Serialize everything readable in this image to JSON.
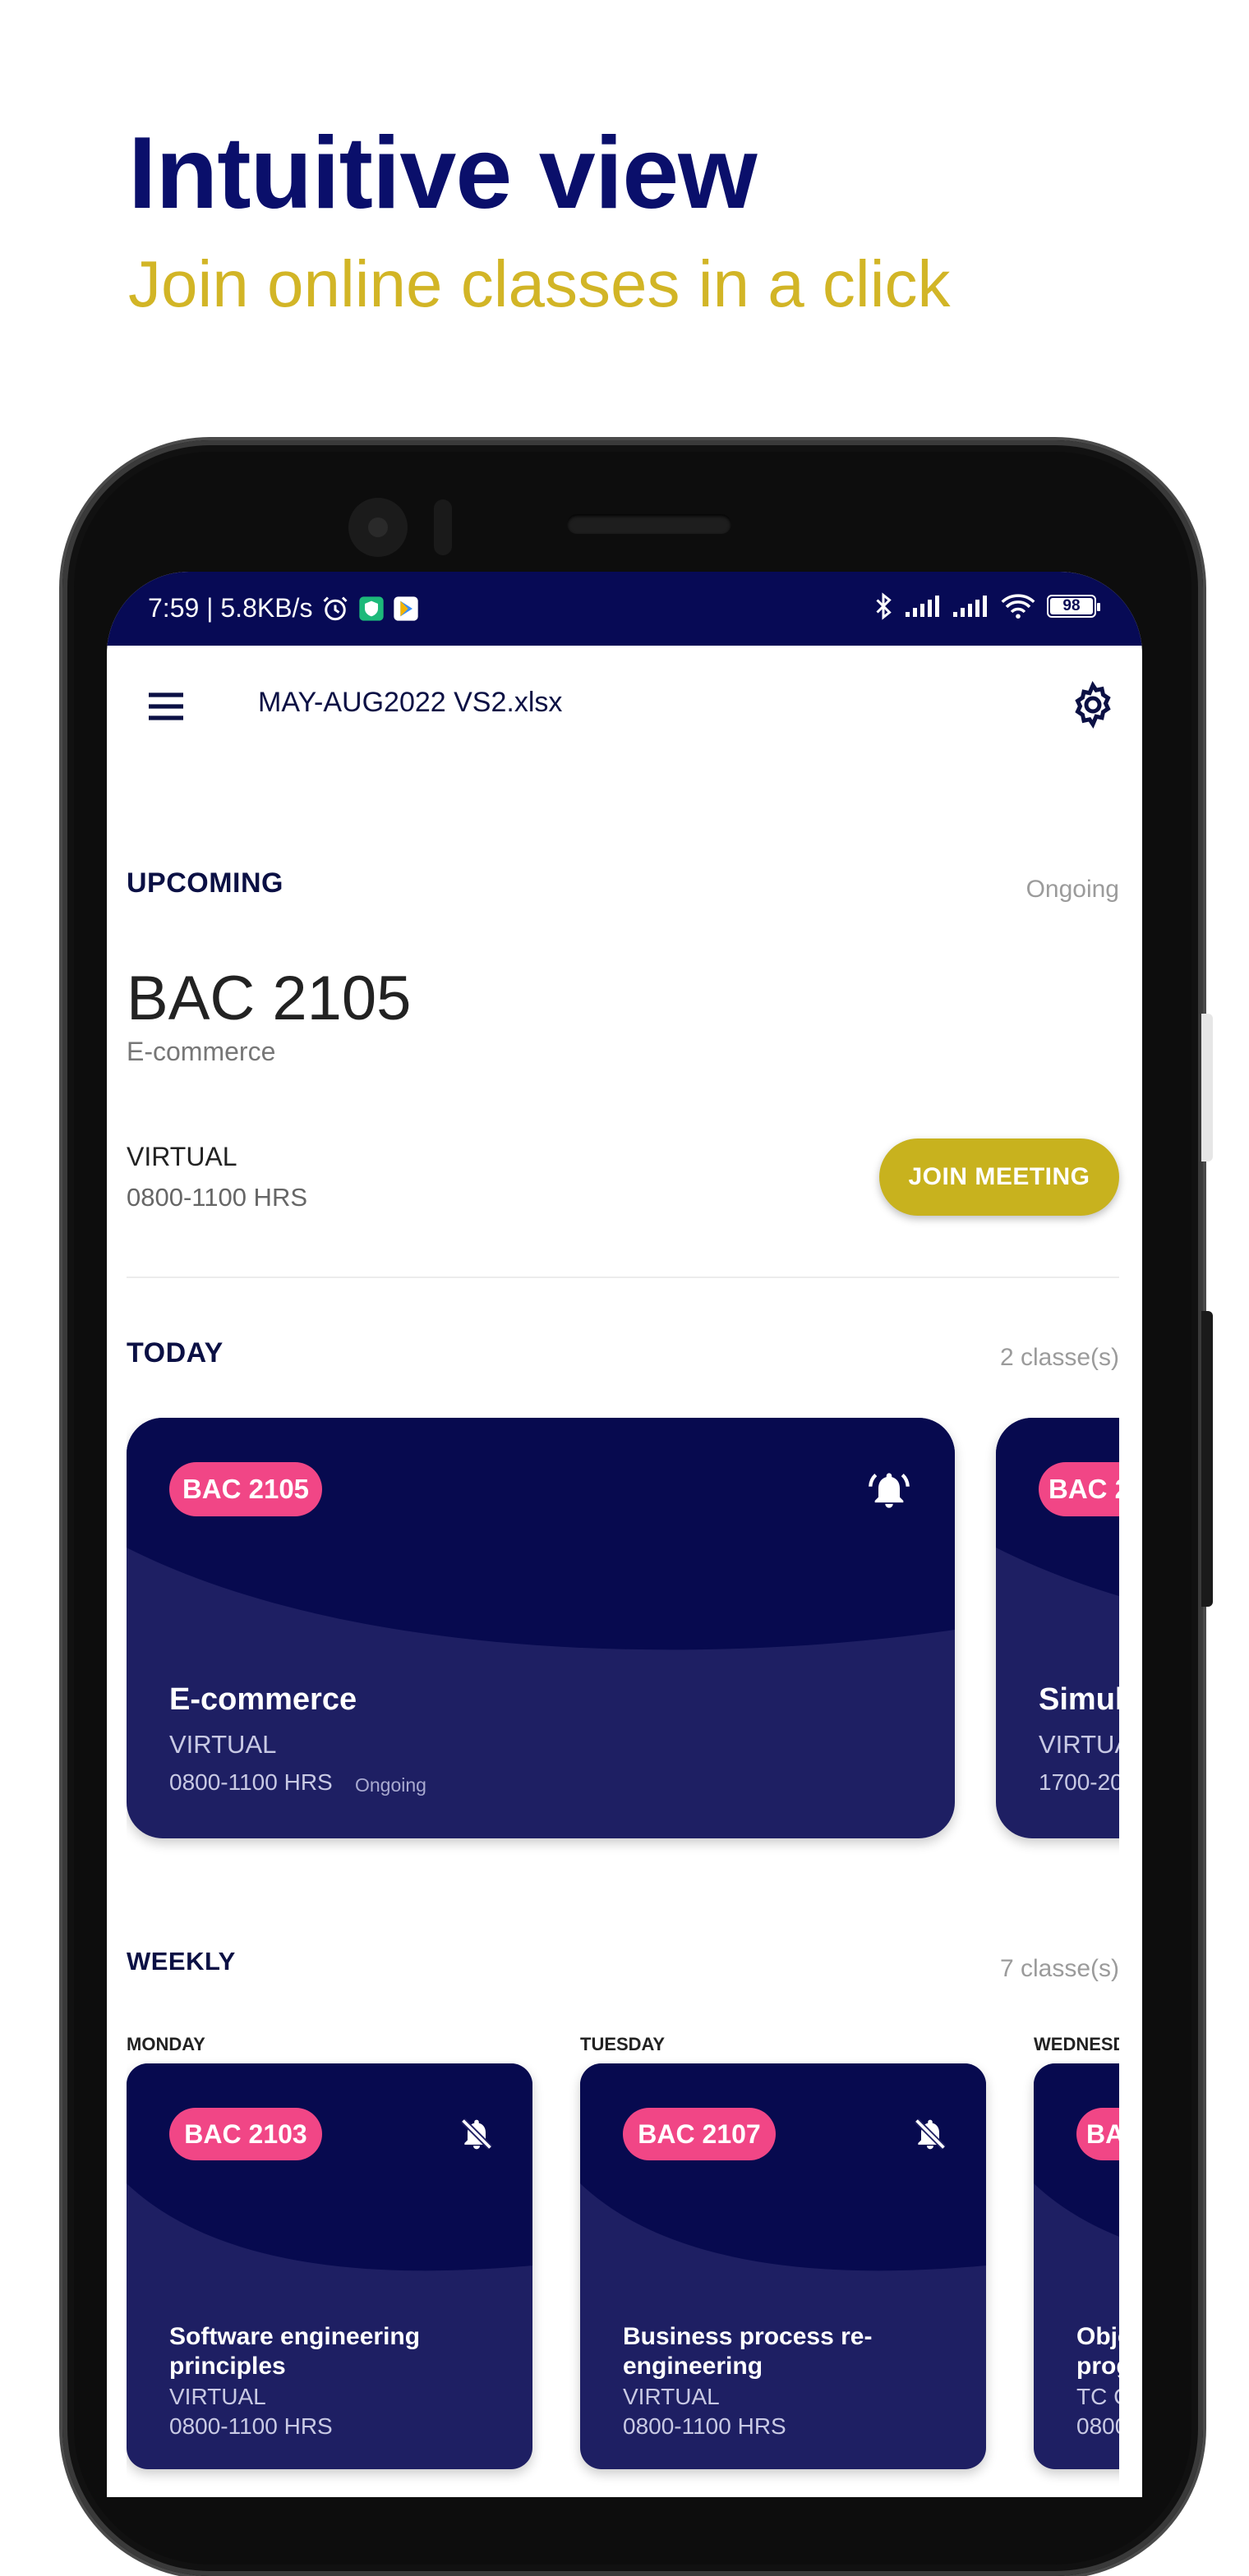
{
  "promo": {
    "headline": "Intuitive view",
    "subline": "Join online classes in a click"
  },
  "status_bar": {
    "time_speed": "7:59 | 5.8KB/s",
    "battery": "98"
  },
  "appbar": {
    "title": "MAY-AUG2022 VS2.xlsx"
  },
  "upcoming": {
    "section": "UPCOMING",
    "status": "Ongoing",
    "code": "BAC 2105",
    "name": "E-commerce",
    "mode": "VIRTUAL",
    "time": "0800-1100 HRS",
    "join_label": "JOIN MEETING"
  },
  "today": {
    "section": "TODAY",
    "count": "2 classe(s)",
    "cards": [
      {
        "code": "BAC 2105",
        "title": "E-commerce",
        "mode": "VIRTUAL",
        "time": "0800-1100 HRS",
        "status": "Ongoing"
      },
      {
        "code": "BAC 2",
        "title": "Simul",
        "mode": "VIRTUA",
        "time": "1700-20"
      }
    ]
  },
  "weekly": {
    "section": "WEEKLY",
    "count": "7 classe(s)",
    "days": [
      {
        "day": "MONDAY",
        "code": "BAC 2103",
        "title_l1": "Software engineering",
        "title_l2": "principles",
        "mode": "VIRTUAL",
        "time": "0800-1100 HRS"
      },
      {
        "day": "TUESDAY",
        "code": "BAC 2107",
        "title_l1": "Business process re-",
        "title_l2": "engineering",
        "mode": "VIRTUAL",
        "time": "0800-1100 HRS"
      },
      {
        "day": "WEDNESD",
        "code": "BA",
        "title_l1": "Obje",
        "title_l2": "prog",
        "mode": "TC C",
        "time": "0800"
      }
    ]
  },
  "colors": {
    "navy": "#070a55",
    "card": "#1e1f63",
    "badge": "#f14686",
    "accent": "#c8b21e"
  }
}
